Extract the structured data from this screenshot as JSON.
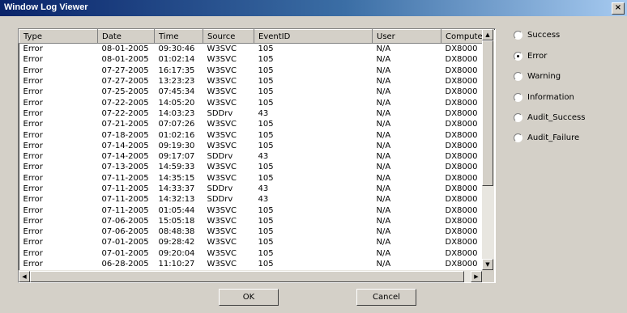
{
  "window": {
    "title": "Window Log Viewer",
    "close_label": "×"
  },
  "columns": [
    "Type",
    "Date",
    "Time",
    "Source",
    "EventID",
    "User",
    "Compute"
  ],
  "rows": [
    [
      "Error",
      "08-01-2005",
      "09:30:46",
      "W3SVC",
      "105",
      "N/A",
      "DX8000"
    ],
    [
      "Error",
      "08-01-2005",
      "01:02:14",
      "W3SVC",
      "105",
      "N/A",
      "DX8000"
    ],
    [
      "Error",
      "07-27-2005",
      "16:17:35",
      "W3SVC",
      "105",
      "N/A",
      "DX8000"
    ],
    [
      "Error",
      "07-27-2005",
      "13:23:23",
      "W3SVC",
      "105",
      "N/A",
      "DX8000"
    ],
    [
      "Error",
      "07-25-2005",
      "07:45:34",
      "W3SVC",
      "105",
      "N/A",
      "DX8000"
    ],
    [
      "Error",
      "07-22-2005",
      "14:05:20",
      "W3SVC",
      "105",
      "N/A",
      "DX8000"
    ],
    [
      "Error",
      "07-22-2005",
      "14:03:23",
      "SDDrv",
      "43",
      "N/A",
      "DX8000"
    ],
    [
      "Error",
      "07-21-2005",
      "07:07:26",
      "W3SVC",
      "105",
      "N/A",
      "DX8000"
    ],
    [
      "Error",
      "07-18-2005",
      "01:02:16",
      "W3SVC",
      "105",
      "N/A",
      "DX8000"
    ],
    [
      "Error",
      "07-14-2005",
      "09:19:30",
      "W3SVC",
      "105",
      "N/A",
      "DX8000"
    ],
    [
      "Error",
      "07-14-2005",
      "09:17:07",
      "SDDrv",
      "43",
      "N/A",
      "DX8000"
    ],
    [
      "Error",
      "07-13-2005",
      "14:59:33",
      "W3SVC",
      "105",
      "N/A",
      "DX8000"
    ],
    [
      "Error",
      "07-11-2005",
      "14:35:15",
      "W3SVC",
      "105",
      "N/A",
      "DX8000"
    ],
    [
      "Error",
      "07-11-2005",
      "14:33:37",
      "SDDrv",
      "43",
      "N/A",
      "DX8000"
    ],
    [
      "Error",
      "07-11-2005",
      "14:32:13",
      "SDDrv",
      "43",
      "N/A",
      "DX8000"
    ],
    [
      "Error",
      "07-11-2005",
      "01:05:44",
      "W3SVC",
      "105",
      "N/A",
      "DX8000"
    ],
    [
      "Error",
      "07-06-2005",
      "15:05:18",
      "W3SVC",
      "105",
      "N/A",
      "DX8000"
    ],
    [
      "Error",
      "07-06-2005",
      "08:48:38",
      "W3SVC",
      "105",
      "N/A",
      "DX8000"
    ],
    [
      "Error",
      "07-01-2005",
      "09:28:42",
      "W3SVC",
      "105",
      "N/A",
      "DX8000"
    ],
    [
      "Error",
      "07-01-2005",
      "09:20:04",
      "W3SVC",
      "105",
      "N/A",
      "DX8000"
    ],
    [
      "Error",
      "06-28-2005",
      "11:10:27",
      "W3SVC",
      "105",
      "N/A",
      "DX8000"
    ]
  ],
  "filters": {
    "options": [
      "Success",
      "Error",
      "Warning",
      "Information",
      "Audit_Success",
      "Audit_Failure"
    ],
    "selected": "Error"
  },
  "buttons": {
    "ok": "OK",
    "cancel": "Cancel"
  },
  "icons": {
    "close": "close-icon",
    "up": "scroll-up-icon",
    "down": "scroll-down-icon",
    "left": "scroll-left-icon",
    "right": "scroll-right-icon"
  }
}
